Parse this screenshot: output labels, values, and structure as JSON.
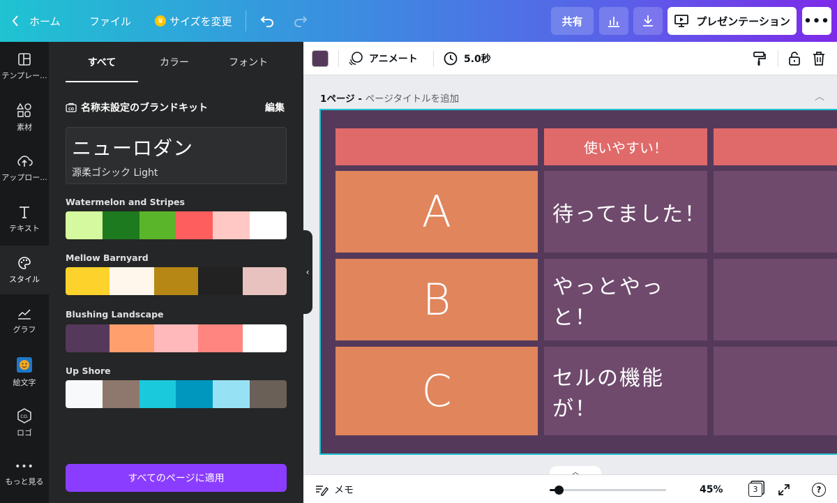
{
  "topbar": {
    "home_label": "ホーム",
    "file_label": "ファイル",
    "resize_label": "サイズを変更",
    "share_label": "共有",
    "present_label": "プレゼンテーション"
  },
  "rail": [
    {
      "label": "テンプレー...",
      "icon": "template-icon"
    },
    {
      "label": "素材",
      "icon": "elements-icon"
    },
    {
      "label": "アップロー...",
      "icon": "upload-icon"
    },
    {
      "label": "テキスト",
      "icon": "text-icon"
    },
    {
      "label": "スタイル",
      "icon": "palette-icon"
    },
    {
      "label": "グラフ",
      "icon": "chart-icon"
    },
    {
      "label": "絵文字",
      "icon": "emoji-icon"
    },
    {
      "label": "ロゴ",
      "icon": "logo-icon"
    },
    {
      "label": "もっと見る",
      "icon": "more-icon"
    }
  ],
  "panel": {
    "tabs": [
      "すべて",
      "カラー",
      "フォント"
    ],
    "kit_title": "名称未設定のブランドキット",
    "kit_edit": "編集",
    "font_title": "ニューロダン",
    "font_subtitle": "源柔ゴシック Light",
    "palettes": [
      {
        "name": "Watermelon and Stripes",
        "colors": [
          "#d5f99e",
          "#1e7a1e",
          "#5bb52a",
          "#ff5e5e",
          "#ffc8c5",
          "#ffffff"
        ]
      },
      {
        "name": "Mellow Barnyard",
        "colors": [
          "#fdd22b",
          "#fff6ec",
          "#b78716",
          "#222222",
          "#e8c2bf"
        ]
      },
      {
        "name": "Blushing Landscape",
        "colors": [
          "#55395a",
          "#ff9f6e",
          "#ffb9bb",
          "#ff8580",
          "#ffffff"
        ]
      },
      {
        "name": "Up Shore",
        "colors": [
          "#f8f9fb",
          "#8e776c",
          "#1bc9dc",
          "#0097bf",
          "#97e1f4",
          "#6a6058"
        ]
      }
    ],
    "apply_label": "すべてのページに適用"
  },
  "editor": {
    "animate_label": "アニメート",
    "duration_label": "5.0秒",
    "page_label": "1ページ - ",
    "page_title_placeholder": "ページタイトルを追加",
    "color": "#55395a"
  },
  "slide": {
    "header_text": "使いやすい！",
    "rows": [
      {
        "key": "A",
        "text": "待ってました！"
      },
      {
        "key": "B",
        "text": "やっとやっと！"
      },
      {
        "key": "C",
        "text": "セルの機能が！"
      }
    ]
  },
  "bottombar": {
    "notes_label": "メモ",
    "zoom_label": "45%",
    "zoom_fraction": 0.08,
    "page_count": "3",
    "help_label": "?"
  }
}
